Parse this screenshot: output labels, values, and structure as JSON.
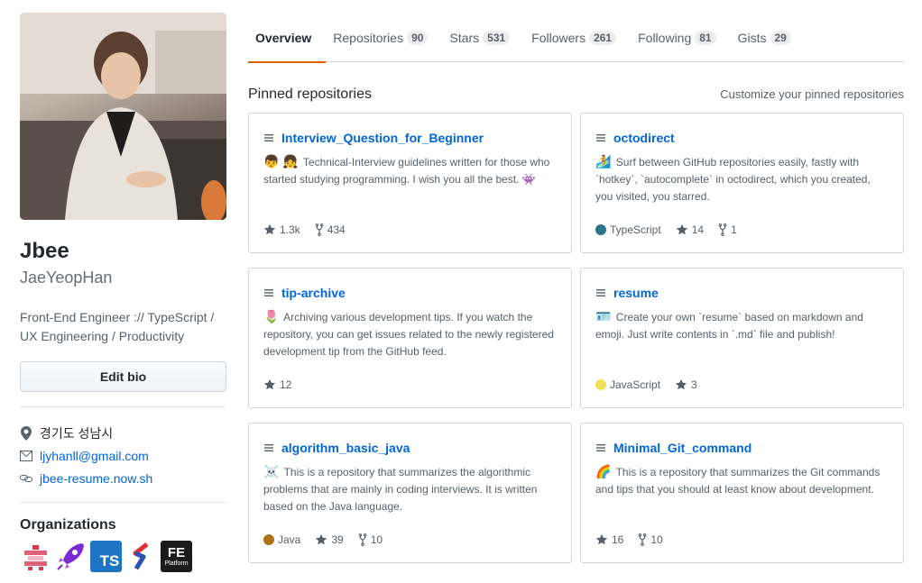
{
  "profile": {
    "name": "Jbee",
    "login": "JaeYeopHan",
    "bio": "Front-End Engineer :// TypeScript / UX Engineering / Productivity",
    "edit_bio_label": "Edit bio",
    "location": "경기도 성남시",
    "email": "ljyhanll@gmail.com",
    "website": "jbee-resume.now.sh"
  },
  "orgs": {
    "title": "Organizations",
    "items": [
      {
        "icon": "pixel-shrine-org-icon"
      },
      {
        "icon": "rocket-org-icon"
      },
      {
        "icon": "typescript-org-icon",
        "text": "TS"
      },
      {
        "icon": "red-blue-s-org-icon"
      },
      {
        "icon": "fe-platform-org-icon",
        "text": "FE",
        "subtext": "Platform"
      }
    ]
  },
  "tabs": [
    {
      "label": "Overview",
      "count": null,
      "selected": true
    },
    {
      "label": "Repositories",
      "count": "90"
    },
    {
      "label": "Stars",
      "count": "531"
    },
    {
      "label": "Followers",
      "count": "261"
    },
    {
      "label": "Following",
      "count": "81"
    },
    {
      "label": "Gists",
      "count": "29"
    }
  ],
  "pinned": {
    "title": "Pinned repositories",
    "customize_label": "Customize your pinned repositories",
    "repos": [
      {
        "name": "Interview_Question_for_Beginner",
        "emoji": "👦 👧",
        "description": "Technical-Interview guidelines written for those who started studying programming. I wish you all the best. 👾",
        "language": null,
        "lang_color": null,
        "stars": "1.3k",
        "forks": "434"
      },
      {
        "name": "octodirect",
        "emoji": "🏄",
        "description": "Surf between GitHub repositories easily, fastly with `hotkey`, `autocomplete` in octodirect, which you created, you visited, you starred.",
        "language": "TypeScript",
        "lang_color": "#2b7489",
        "stars": "14",
        "forks": "1"
      },
      {
        "name": "tip-archive",
        "emoji": "🌷",
        "description": "Archiving various development tips. If you watch the repository, you can get issues related to the newly registered development tip from the GitHub feed.",
        "language": null,
        "lang_color": null,
        "stars": "12",
        "forks": null
      },
      {
        "name": "resume",
        "emoji": "🪪",
        "description": "Create your own `resume` based on markdown and emoji. Just write contents in `.md` file and publish!",
        "language": "JavaScript",
        "lang_color": "#f1e05a",
        "stars": "3",
        "forks": null
      },
      {
        "name": "algorithm_basic_java",
        "emoji": "☠️",
        "description": "This is a repository that summarizes the algorithmic problems that are mainly in coding interviews. It is written based on the Java language.",
        "language": "Java",
        "lang_color": "#b07219",
        "stars": "39",
        "forks": "10"
      },
      {
        "name": "Minimal_Git_command",
        "emoji": "🌈",
        "description": "This is a repository that summarizes the Git commands and tips that you should at least know about development.",
        "language": null,
        "lang_color": null,
        "stars": "16",
        "forks": "10"
      }
    ]
  }
}
